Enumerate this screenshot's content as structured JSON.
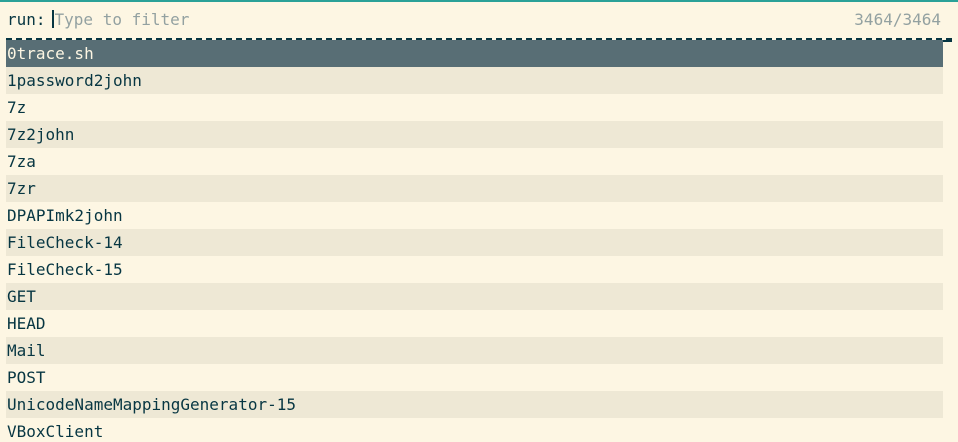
{
  "prompt": {
    "label": "run:",
    "placeholder": "Type to filter",
    "value": "",
    "count": "3464/3464"
  },
  "colors": {
    "background": "#fdf6e3",
    "row_alt": "#eee8d5",
    "selected": "#586e75",
    "text": "#073642",
    "muted": "#93a1a1"
  },
  "entries": [
    "0trace.sh",
    "1password2john",
    "7z",
    "7z2john",
    "7za",
    "7zr",
    "DPAPImk2john",
    "FileCheck-14",
    "FileCheck-15",
    "GET",
    "HEAD",
    "Mail",
    "POST",
    "UnicodeNameMappingGenerator-15",
    "VBoxClient"
  ],
  "selected_index": 0
}
